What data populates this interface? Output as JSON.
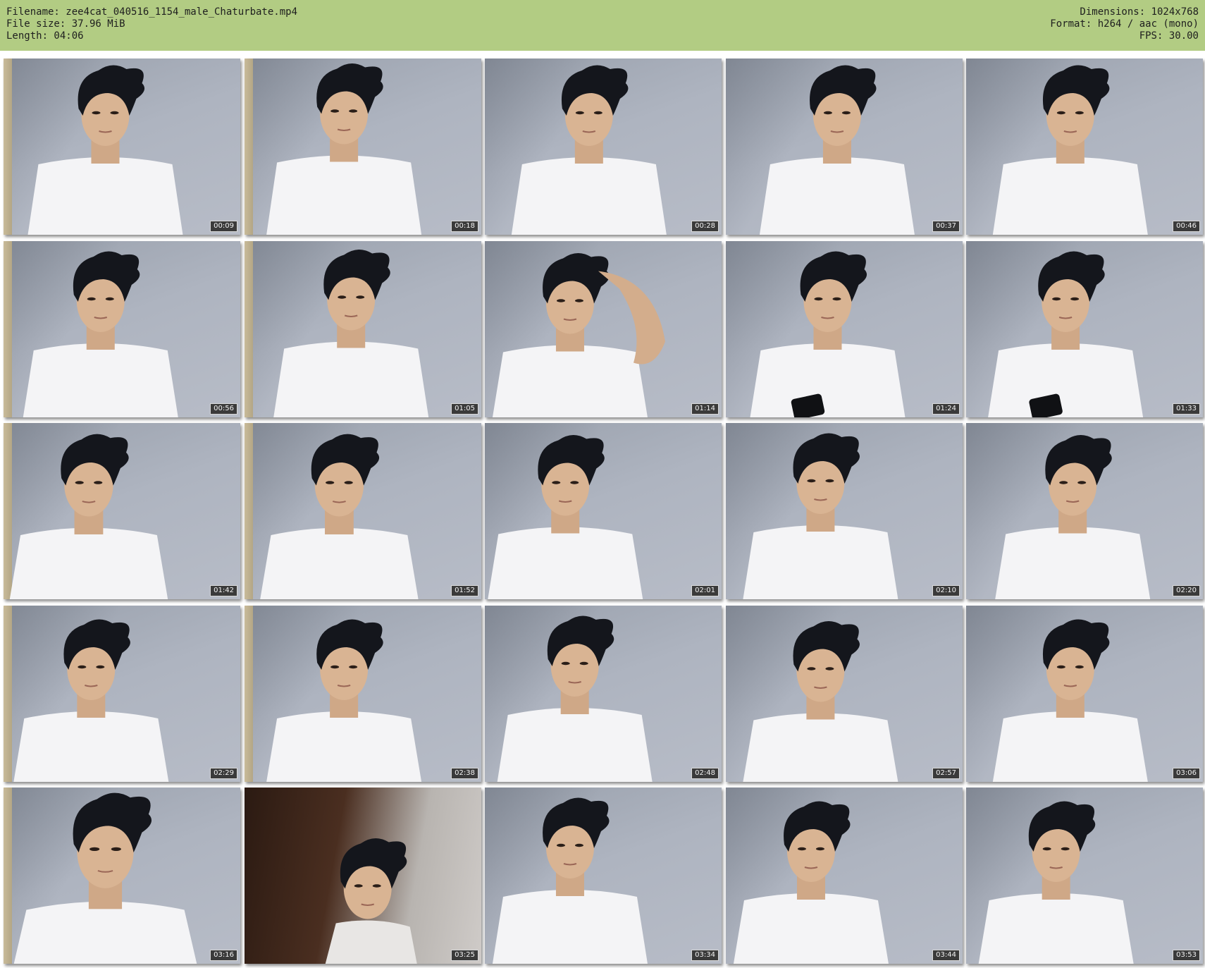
{
  "header": {
    "filename": "Filename: zee4cat_040516_1154_male_Chaturbate.mp4",
    "filesize": "File size: 37.96 MiB",
    "length": "Length: 04:06",
    "dimensions": "Dimensions: 1024x768",
    "format": "Format: h264 / aac (mono)",
    "fps": "FPS: 30.00"
  },
  "colors": {
    "header_bg": "#b2cc83",
    "wall": "#aeb4c0",
    "hair": "#14161c",
    "skin": "#d9b493",
    "shirt": "#f4f4f6"
  },
  "thumbnails": [
    {
      "time": "00:09"
    },
    {
      "time": "00:18"
    },
    {
      "time": "00:28"
    },
    {
      "time": "00:37"
    },
    {
      "time": "00:46"
    },
    {
      "time": "00:56"
    },
    {
      "time": "01:05"
    },
    {
      "time": "01:14"
    },
    {
      "time": "01:24"
    },
    {
      "time": "01:33"
    },
    {
      "time": "01:42"
    },
    {
      "time": "01:52"
    },
    {
      "time": "02:01"
    },
    {
      "time": "02:10"
    },
    {
      "time": "02:20"
    },
    {
      "time": "02:29"
    },
    {
      "time": "02:38"
    },
    {
      "time": "02:48"
    },
    {
      "time": "02:57"
    },
    {
      "time": "03:06"
    },
    {
      "time": "03:16"
    },
    {
      "time": "03:25"
    },
    {
      "time": "03:34"
    },
    {
      "time": "03:44"
    },
    {
      "time": "03:53"
    }
  ]
}
